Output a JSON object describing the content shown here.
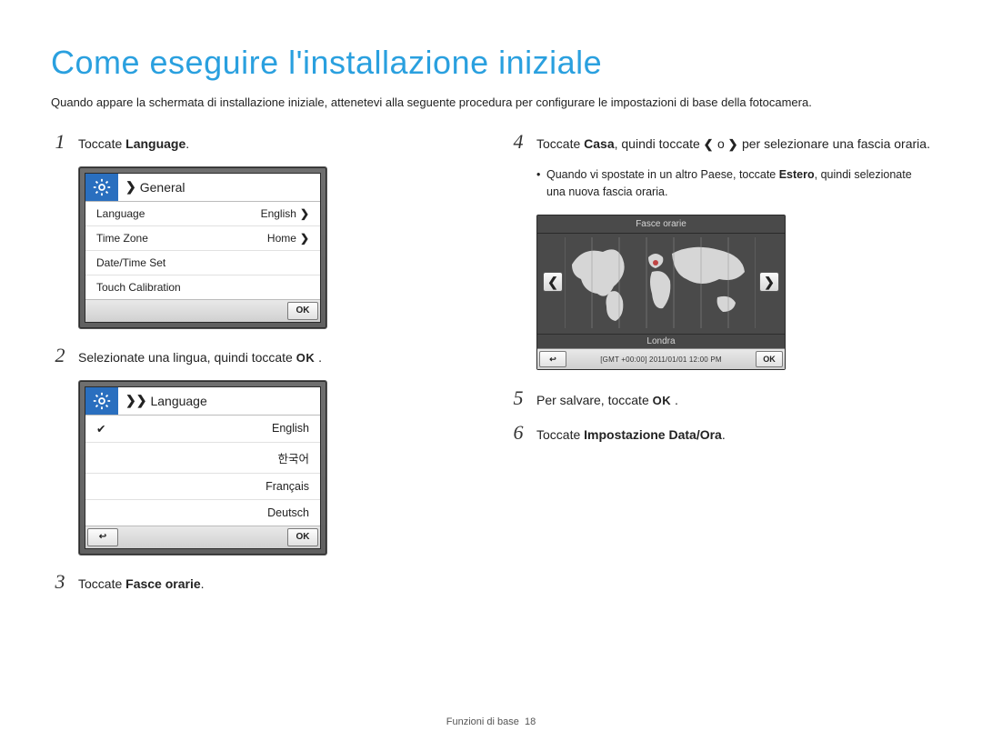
{
  "title": "Come eseguire l'installazione iniziale",
  "intro": "Quando appare la schermata di installazione iniziale, attenetevi alla seguente procedura per configurare le impostazioni di base della fotocamera.",
  "steps": {
    "s1": {
      "num": "1",
      "pre": "Toccate ",
      "bold": "Language",
      "post": "."
    },
    "s2": {
      "num": "2",
      "pre": "Selezionate una lingua, quindi toccate ",
      "ok": "OK",
      "post": " ."
    },
    "s3": {
      "num": "3",
      "pre": "Toccate ",
      "bold": "Fasce orarie",
      "post": "."
    },
    "s4": {
      "num": "4",
      "pre": "Toccate ",
      "bold": "Casa",
      "mid": ", quindi toccate ",
      "arrL": "❮",
      "or": " o ",
      "arrR": "❯",
      "post": " per selezionare una fascia oraria."
    },
    "s4sub": {
      "pre": "Quando vi spostate in un altro Paese, toccate ",
      "bold": "Estero",
      "post": ", quindi selezionate una nuova fascia oraria."
    },
    "s5": {
      "num": "5",
      "pre": "Per salvare, toccate ",
      "ok": "OK",
      "post": " ."
    },
    "s6": {
      "num": "6",
      "pre": "Toccate ",
      "bold": "Impostazione Data/Ora",
      "post": "."
    }
  },
  "screen1": {
    "crumb_chev": "❯",
    "crumb": "General",
    "rows": [
      {
        "label": "Language",
        "value": "English",
        "chev": "❯"
      },
      {
        "label": "Time Zone",
        "value": "Home",
        "chev": "❯"
      },
      {
        "label": "Date/Time Set",
        "value": "",
        "chev": ""
      },
      {
        "label": "Touch Calibration",
        "value": "",
        "chev": ""
      }
    ],
    "ok": "OK"
  },
  "screen2": {
    "crumb_chev": "❯❯",
    "crumb": "Language",
    "rows": [
      {
        "check": "✔",
        "label": "English"
      },
      {
        "check": "",
        "label": "한국어"
      },
      {
        "check": "",
        "label": "Français"
      },
      {
        "check": "",
        "label": "Deutsch"
      }
    ],
    "back": "↩",
    "ok": "OK"
  },
  "screen3": {
    "title": "Fasce orarie",
    "arrow_left": "❮",
    "arrow_right": "❯",
    "city": "Londra",
    "gmt": "[GMT +00:00] 2011/01/01 12:00 PM",
    "back": "↩",
    "ok": "OK"
  },
  "footer": {
    "label": "Funzioni di base",
    "page": "18"
  }
}
